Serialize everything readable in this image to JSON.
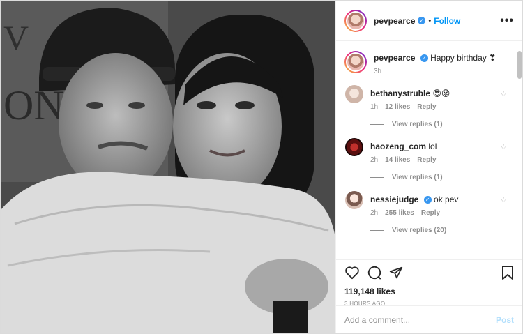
{
  "post": {
    "username": "pevpearce",
    "follow_label": "Follow",
    "more_label": "•••",
    "verified_glyph": "✓",
    "separator": "•"
  },
  "caption": {
    "username": "pevpearce",
    "text": "Happy birthday ❣",
    "time": "3h"
  },
  "comments": [
    {
      "username": "bethanystruble",
      "text": "😍😟",
      "time": "1h",
      "likes": "12 likes",
      "reply": "Reply",
      "view_replies": "View replies (1)",
      "verified": false
    },
    {
      "username": "haozeng_com",
      "text": "lol",
      "time": "2h",
      "likes": "14 likes",
      "reply": "Reply",
      "view_replies": "View replies (1)",
      "verified": false
    },
    {
      "username": "nessiejudge",
      "text": "ok pev",
      "time": "2h",
      "likes": "255 likes",
      "reply": "Reply",
      "view_replies": "View replies (20)",
      "verified": true
    }
  ],
  "icons": {
    "like": "heart-icon",
    "comment": "comment-icon",
    "share": "share-icon",
    "save": "bookmark-icon",
    "comment_like": "small-heart-icon"
  },
  "stats": {
    "likes": "119,148 likes",
    "time_ago": "3 HOURS AGO"
  },
  "add_comment": {
    "placeholder": "Add a comment...",
    "post_label": "Post"
  },
  "colors": {
    "link": "#0095f6",
    "verified": "#3897f0",
    "muted": "#8e8e8e",
    "post_disabled": "#b2dffc"
  }
}
